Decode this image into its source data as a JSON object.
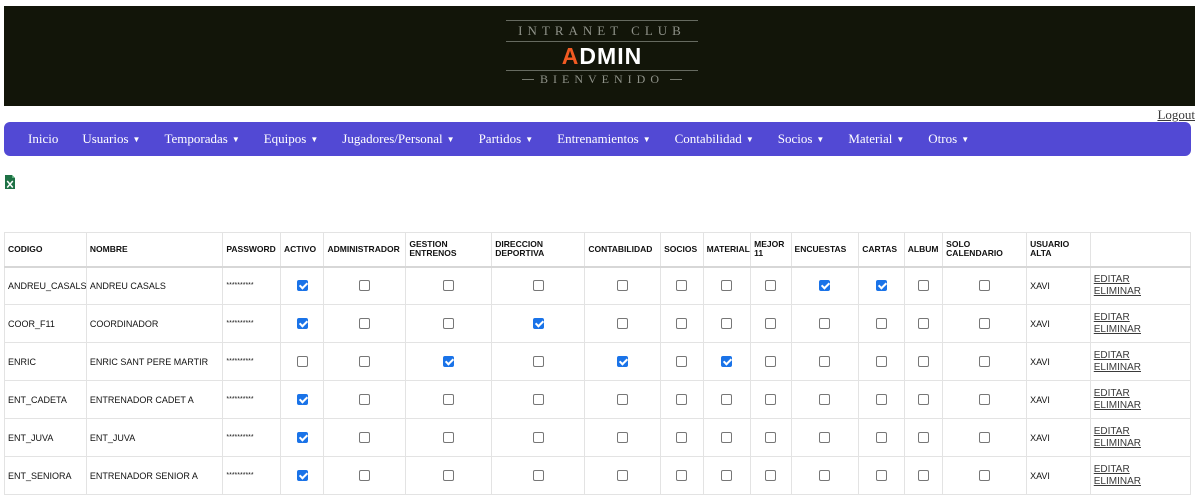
{
  "header": {
    "logo_top": "INTRANET CLUB",
    "logo_main_first": "A",
    "logo_main_rest": "DMIN",
    "logo_bottom": "BIENVENIDO"
  },
  "logout_label": "Logout",
  "nav": [
    {
      "label": "Inicio",
      "caret": false
    },
    {
      "label": "Usuarios",
      "caret": true
    },
    {
      "label": "Temporadas",
      "caret": true
    },
    {
      "label": "Equipos",
      "caret": true
    },
    {
      "label": "Jugadores/Personal",
      "caret": true
    },
    {
      "label": "Partidos",
      "caret": true
    },
    {
      "label": "Entrenamientos",
      "caret": true
    },
    {
      "label": "Contabilidad",
      "caret": true
    },
    {
      "label": "Socios",
      "caret": true
    },
    {
      "label": "Material",
      "caret": true
    },
    {
      "label": "Otros",
      "caret": true
    }
  ],
  "caret_glyph": "▼",
  "excel_icon": "excel-export-icon",
  "colors": {
    "nav_bg": "#5249d4",
    "header_bg": "#121509",
    "accent": "#f15a22",
    "checkbox_on": "#1a73e8"
  },
  "table": {
    "columns": [
      "CODIGO",
      "NOMBRE",
      "PASSWORD",
      "ACTIVO",
      "ADMINISTRADOR",
      "GESTION ENTRENOS",
      "DIRECCION DEPORTIVA",
      "CONTABILIDAD",
      "SOCIOS",
      "MATERIAL",
      "MEJOR 11",
      "ENCUESTAS",
      "CARTAS",
      "ALBUM",
      "SOLO CALENDARIO",
      "USUARIO ALTA",
      ""
    ],
    "edit_label": "EDITAR",
    "delete_label": "ELIMINAR",
    "rows": [
      {
        "codigo": "ANDREU_CASALS",
        "nombre": "ANDREU CASALS",
        "password": "**********",
        "flags": [
          true,
          false,
          false,
          false,
          false,
          false,
          false,
          false,
          true,
          true,
          false,
          false
        ],
        "usuario_alta": "XAVI"
      },
      {
        "codigo": "COOR_F11",
        "nombre": "COORDINADOR",
        "password": "**********",
        "flags": [
          true,
          false,
          false,
          true,
          false,
          false,
          false,
          false,
          false,
          false,
          false,
          false
        ],
        "usuario_alta": "XAVI"
      },
      {
        "codigo": "ENRIC",
        "nombre": "ENRIC SANT PERE MARTIR",
        "password": "**********",
        "flags": [
          false,
          false,
          true,
          false,
          true,
          false,
          true,
          false,
          false,
          false,
          false,
          false
        ],
        "usuario_alta": "XAVI"
      },
      {
        "codigo": "ENT_CADETA",
        "nombre": "ENTRENADOR CADET A",
        "password": "**********",
        "flags": [
          true,
          false,
          false,
          false,
          false,
          false,
          false,
          false,
          false,
          false,
          false,
          false
        ],
        "usuario_alta": "XAVI"
      },
      {
        "codigo": "ENT_JUVA",
        "nombre": "ENT_JUVA",
        "password": "**********",
        "flags": [
          true,
          false,
          false,
          false,
          false,
          false,
          false,
          false,
          false,
          false,
          false,
          false
        ],
        "usuario_alta": "XAVI"
      },
      {
        "codigo": "ENT_SENIORA",
        "nombre": "ENTRENADOR SENIOR A",
        "password": "**********",
        "flags": [
          true,
          false,
          false,
          false,
          false,
          false,
          false,
          false,
          false,
          false,
          false,
          false
        ],
        "usuario_alta": "XAVI"
      }
    ]
  }
}
